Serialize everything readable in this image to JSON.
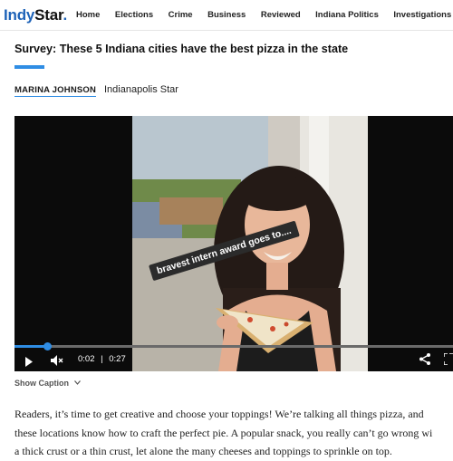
{
  "site": {
    "logo_part1": "Indy",
    "logo_part2": "Star",
    "logo_dot": ".",
    "nav": [
      "Home",
      "Elections",
      "Crime",
      "Business",
      "Reviewed",
      "Indiana Politics",
      "Investigations"
    ]
  },
  "article": {
    "headline": "Survey: These 5 Indiana cities have the best pizza in the state",
    "author": "MARINA JOHNSON",
    "publication": "Indianapolis Star",
    "body_lines": [
      "Readers, it’s time to get creative and choose your toppings! We’re talking all things pizza, and",
      "these locations know how to craft the perfect pie. A popular snack, you really can’t go wrong wi",
      "a thick crust or a thin crust, let alone the many cheeses and toppings to sprinkle on top."
    ]
  },
  "video": {
    "overlay_text": "bravest intern award goes to....",
    "current_time": "0:02",
    "separator": "|",
    "duration": "0:27",
    "progress": 0.075,
    "caption_toggle": "Show Caption"
  },
  "colors": {
    "accent": "#2f8de4",
    "brand": "#1e63b8",
    "video_bg": "#0b0b0b"
  },
  "icons": [
    "play-icon",
    "volume-muted-icon",
    "share-icon",
    "fullscreen-icon",
    "chevron-down-icon"
  ]
}
